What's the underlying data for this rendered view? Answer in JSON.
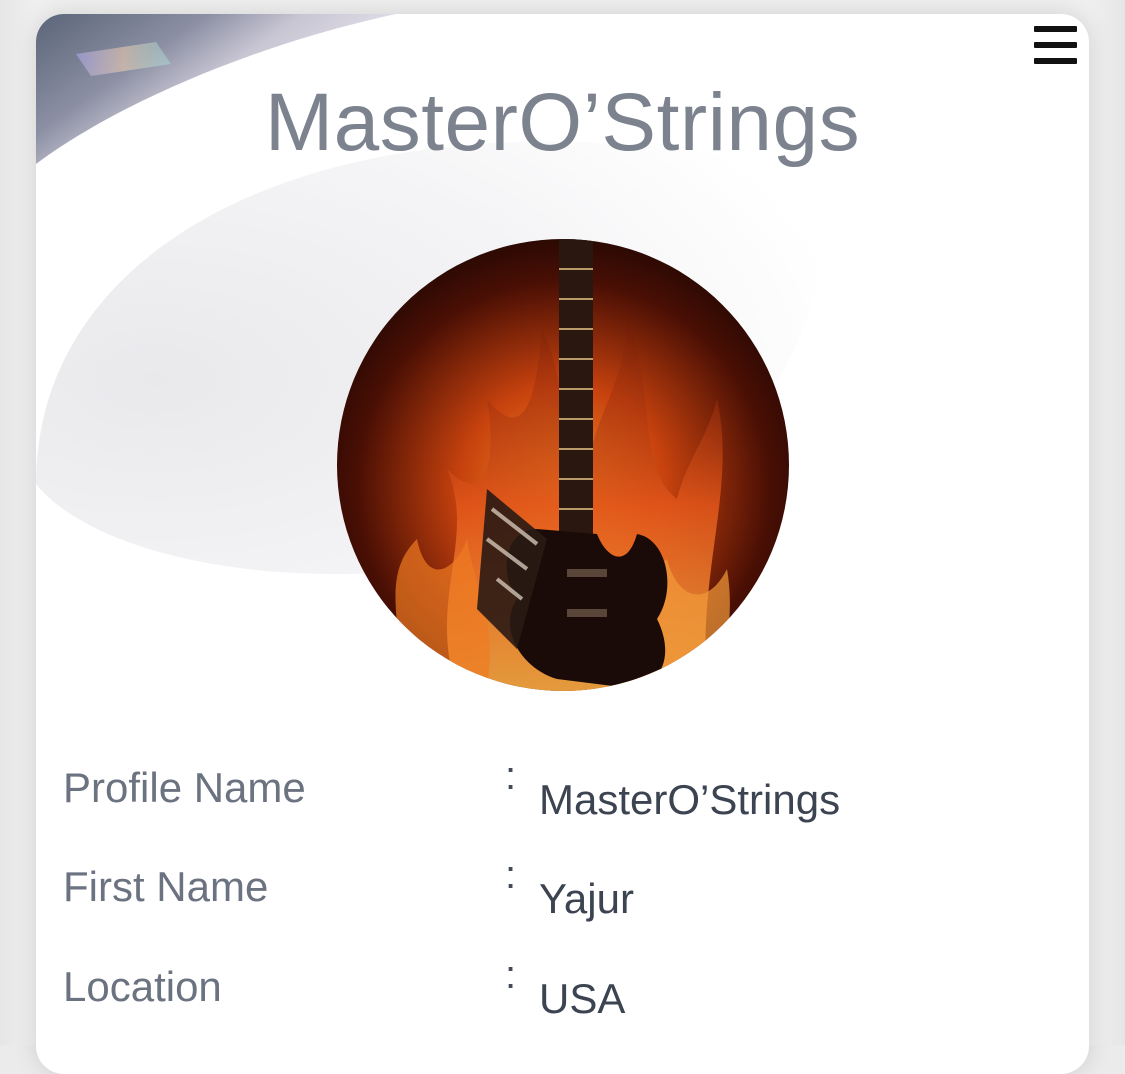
{
  "header": {
    "title": "MasterO’Strings",
    "menu_icon": "hamburger-menu-icon"
  },
  "avatar": {
    "description_icon": "flaming-guitar-image"
  },
  "profile": {
    "rows": [
      {
        "label": "Profile Name",
        "separator": ":",
        "value": "MasterO’Strings"
      },
      {
        "label": "First Name",
        "separator": ":",
        "value": "Yajur"
      },
      {
        "label": "Location",
        "separator": ":",
        "value": "USA"
      }
    ]
  },
  "colors": {
    "title": "#7c838e",
    "label": "#6b7280",
    "value": "#3c4452",
    "background": "#ffffff"
  }
}
